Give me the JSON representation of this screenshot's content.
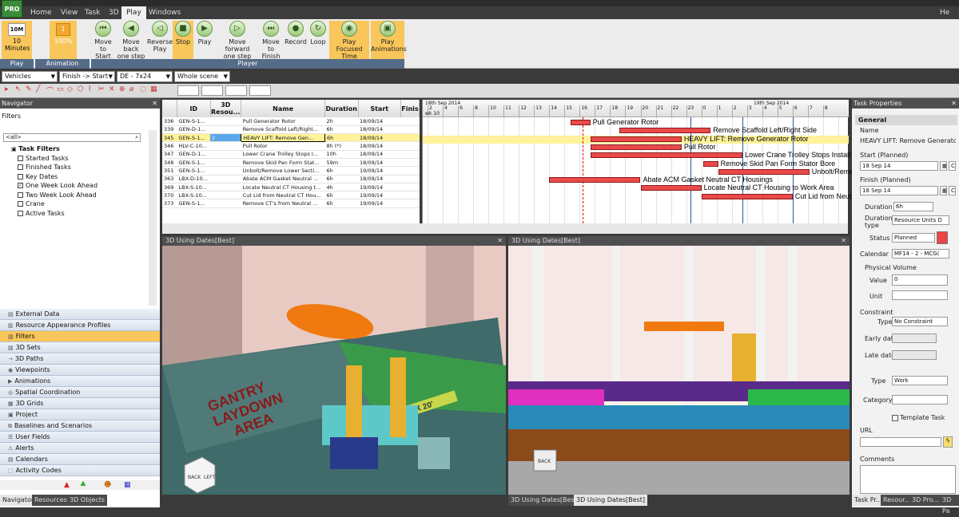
{
  "menu": {
    "logo": "PRO",
    "items": [
      "Home",
      "View",
      "Task",
      "3D",
      "Play",
      "Windows"
    ],
    "active": "Play",
    "right_label": "He"
  },
  "ribbon": {
    "speed_value": "10M",
    "speed_label": "10 Minutes",
    "speed_group": "Play Speed",
    "anim_value": "1",
    "anim_pct": "100%",
    "anim_group": "Animation Speed",
    "player_group": "Player",
    "buttons": [
      {
        "l1": "Move",
        "l2": "to Start"
      },
      {
        "l1": "Move back",
        "l2": "one step"
      },
      {
        "l1": "Reverse",
        "l2": "Play"
      },
      {
        "l1": "Stop",
        "l2": ""
      },
      {
        "l1": "Play",
        "l2": ""
      },
      {
        "l1": "Move forward",
        "l2": "one step"
      },
      {
        "l1": "Move to",
        "l2": "Finish"
      },
      {
        "l1": "Record",
        "l2": ""
      },
      {
        "l1": "Loop",
        "l2": ""
      },
      {
        "l1": "Play Focused",
        "l2": "Time"
      },
      {
        "l1": "Play",
        "l2": "Animations"
      }
    ]
  },
  "toolbar": {
    "vehicles": "Vehicles",
    "direction": "Finish -> Start",
    "schedule": "DE - 7x24",
    "scene": "Whole scene"
  },
  "navigator": {
    "title": "Navigator",
    "filters_label": "Filters",
    "search_value": "<all>",
    "tree_root": "Task Filters",
    "tree_items": [
      "Started Tasks",
      "Finished Tasks",
      "Key Dates",
      "One Week Look Ahead",
      "Two Week Look Ahead",
      "Crane",
      "Active Tasks"
    ],
    "sections": [
      "External Data",
      "Resource Appearance Profiles",
      "Filters",
      "3D Sets",
      "3D Paths",
      "Viewpoints",
      "Animations",
      "Spatial Coordination",
      "3D Grids",
      "Project",
      "Baselines and Scenarios",
      "User Fields",
      "Alerts",
      "Calendars",
      "Activity Codes"
    ],
    "active_section": "Filters",
    "bottom_tabs": [
      "Navigator",
      "Resources",
      "3D Objects"
    ]
  },
  "grid": {
    "headers": [
      "ID",
      "3D Resou...",
      "Name",
      "Duration",
      "Start",
      "Finis"
    ],
    "rows": [
      {
        "num": "336",
        "id": "GEN-S-1...",
        "res": "",
        "name": "Pull Generator Rotor",
        "dur": "2h",
        "start": "18/09/14"
      },
      {
        "num": "339",
        "id": "GEN-D-1...",
        "res": "",
        "name": "Remove Scaffold Left/Right...",
        "dur": "6h",
        "start": "18/09/14"
      },
      {
        "num": "345",
        "id": "GEN-S-1...",
        "res": "2",
        "name": "HEAVY LIFT:  Remove Gen...",
        "dur": "6h",
        "start": "18/09/14"
      },
      {
        "num": "346",
        "id": "HLV-C-10...",
        "res": "",
        "name": "Pull Rotor",
        "dur": "8h (*)",
        "start": "18/09/14"
      },
      {
        "num": "347",
        "id": "GEN-D-1...",
        "res": "",
        "name": "Lower Crane Trolley Stops I...",
        "dur": "10h",
        "start": "18/09/14"
      },
      {
        "num": "348",
        "id": "GEN-S-1...",
        "res": "",
        "name": "Remove Skid Pan Form Stat...",
        "dur": "59m",
        "start": "18/09/14"
      },
      {
        "num": "351",
        "id": "GEN-S-1...",
        "res": "",
        "name": "Unbolt/Remove Lower Secti...",
        "dur": "6h",
        "start": "19/09/14"
      },
      {
        "num": "363",
        "id": "LBX-D-10...",
        "res": "",
        "name": "Abate ACM Gasket Neutral ...",
        "dur": "6h",
        "start": "18/09/14"
      },
      {
        "num": "369",
        "id": "LBX-S-10...",
        "res": "",
        "name": "Locate Neutral CT Housing t...",
        "dur": "4h",
        "start": "19/09/14"
      },
      {
        "num": "370",
        "id": "LBX-S-10...",
        "res": "",
        "name": "Cut Lid from Neutral CT Hou...",
        "dur": "6h",
        "start": "19/09/14"
      },
      {
        "num": "373",
        "id": "GEN-S-1...",
        "res": "",
        "name": "Remove CT's from Neutral ...",
        "dur": "6h",
        "start": "19/09/14"
      }
    ],
    "tabs": [
      "Support",
      "Gantt",
      "Rules"
    ],
    "active_tab": "Gantt"
  },
  "gantt": {
    "date_left": "18th Sep 2014",
    "date_right": "19th Sep 2014",
    "week": "wk 10",
    "hours": [
      "2",
      "4",
      "6",
      "8",
      "10",
      "11",
      "12",
      "13",
      "14",
      "15",
      "16",
      "17",
      "18",
      "19",
      "20",
      "21",
      "22",
      "23",
      "0",
      "1",
      "2",
      "3",
      "4",
      "5",
      "6",
      "7",
      "8"
    ],
    "bars": [
      {
        "label": "Pull Generator Rotor",
        "start": 10.4,
        "end": 11.7
      },
      {
        "label": "Remove Scaffold Left/Right Side",
        "start": 13.6,
        "end": 19.6
      },
      {
        "label": "HEAVY LIFT:  Remove Generator Rotor",
        "start": 11.7,
        "end": 17.7
      },
      {
        "label": "Pull Rotor",
        "start": 11.7,
        "end": 17.7
      },
      {
        "label": "Lower Crane Trolley Stops Install",
        "start": 11.7,
        "end": 21.7
      },
      {
        "label": "Remove Skid Pan Form Stator Bore",
        "start": 19.1,
        "end": 20.1
      },
      {
        "label": "Unbolt/Remove Lower",
        "start": 20.1,
        "end": 26.1
      },
      {
        "label": "Abate ACM Gasket Neutral CT Housings",
        "start": 9.0,
        "end": 15.0
      },
      {
        "label": "Locate Neutral CT Housing to Work Area",
        "start": 15.0,
        "end": 19.0
      },
      {
        "label": "Cut Lid from Neutral",
        "start": 19.0,
        "end": 25.0
      }
    ]
  },
  "views": {
    "left_title": "3D Using Dates[Best]",
    "right_title": "3D Using Dates[Best]",
    "bottom_tabs": [
      "3D Using Dates[Best]",
      "3D Using Dates[Best]"
    ],
    "floor_text_1": "GANTRY",
    "floor_text_2": "LAYDOWN",
    "floor_text_3": "AREA",
    "sign_text": "8' X 20'",
    "cube_front": "BACK",
    "cube_side": "LEFT",
    "back_label": "BACK"
  },
  "props": {
    "title": "Task Properties",
    "section": "General",
    "name_label": "Name",
    "name_value": "HEAVY LIFT:  Remove Generato",
    "start_label": "Start (Planned)",
    "start_value": "18  Sep  14",
    "finish_label": "Finish (Planned)",
    "finish_value": "18  Sep  14",
    "duration_label": "Duration",
    "duration_value": "6h",
    "duration_type_label": "Duration type",
    "duration_type_value": "Resource Units D",
    "status_label": "Status",
    "status_value": "Planned",
    "status_color": "#ee4444",
    "calendar_label": "Calendar",
    "calendar_value": "MF14 - 2 - MCG(",
    "physical_volume_label": "Physical Volume",
    "value_label": "Value",
    "value_value": "0",
    "unit_label": "Unit",
    "constraint_label": "Constraint",
    "type_label": "Type",
    "constraint_type_value": "No Constraint",
    "early_label": "Early date",
    "late_label": "Late date",
    "task_type_label": "Type",
    "task_type_value": "Work",
    "category_label": "Category",
    "template_label": "Template Task",
    "url_label": "URL",
    "comments_label": "Comments",
    "bottom_tabs": [
      "Task Pr...",
      "Resour...",
      "3D Pro...",
      "3D Pa"
    ]
  }
}
